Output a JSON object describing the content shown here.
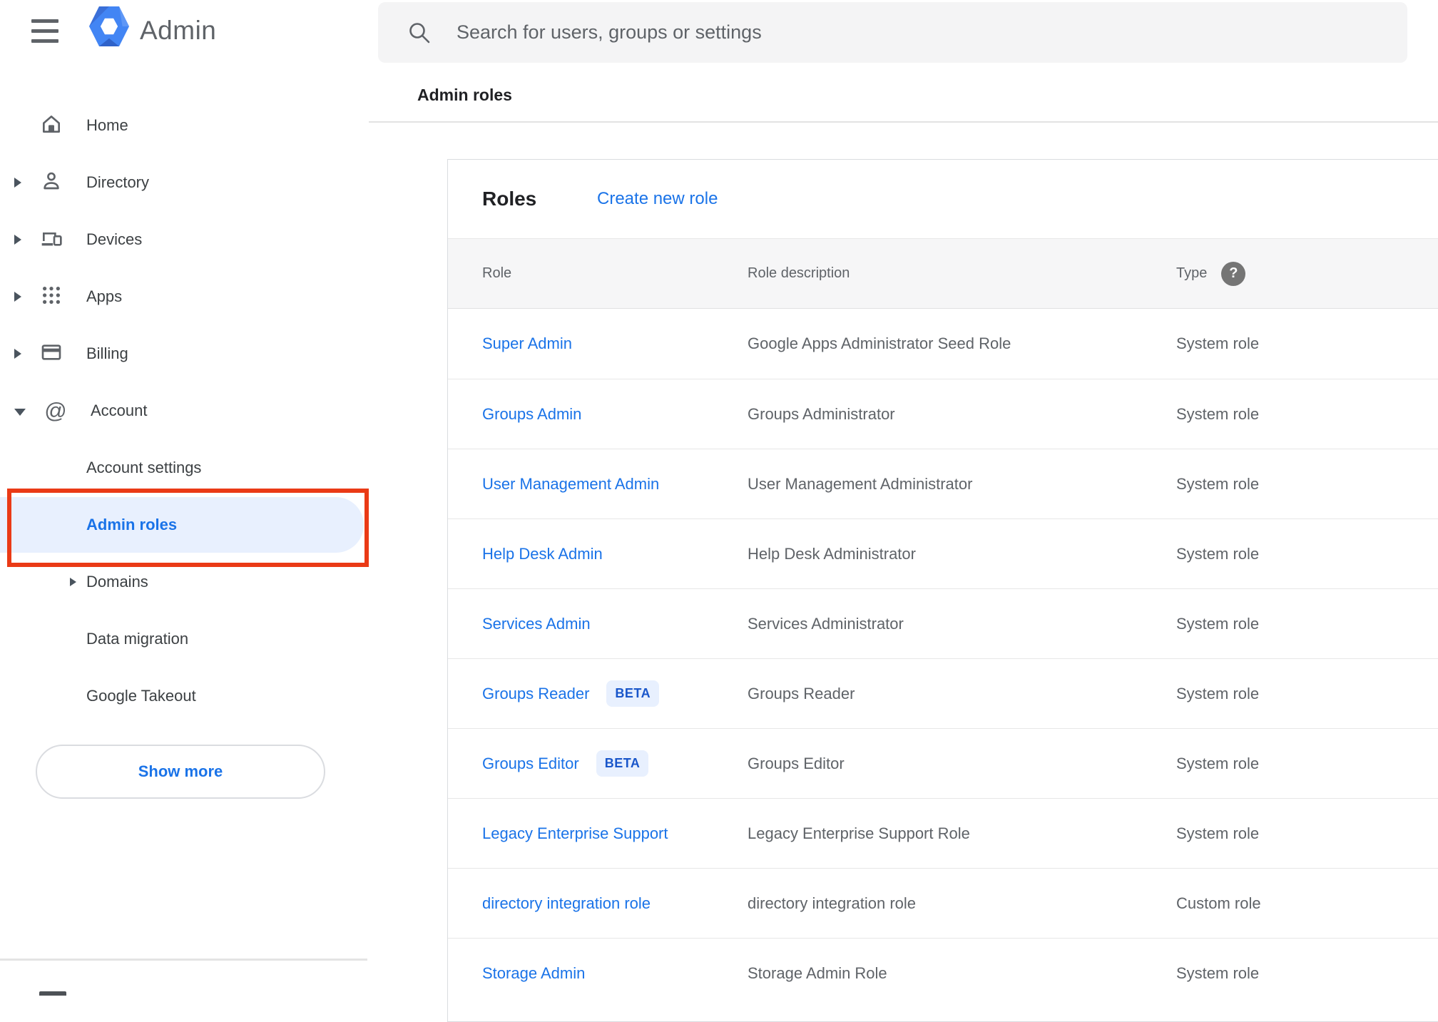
{
  "app": {
    "title": "Admin"
  },
  "search": {
    "placeholder": "Search for users, groups or settings"
  },
  "breadcrumb": "Admin roles",
  "sidebar": {
    "items": [
      {
        "label": "Home",
        "icon": "home",
        "expandable": false,
        "expanded": false
      },
      {
        "label": "Directory",
        "icon": "person",
        "expandable": true,
        "expanded": false
      },
      {
        "label": "Devices",
        "icon": "devices",
        "expandable": true,
        "expanded": false
      },
      {
        "label": "Apps",
        "icon": "apps",
        "expandable": true,
        "expanded": false
      },
      {
        "label": "Billing",
        "icon": "card",
        "expandable": true,
        "expanded": false
      },
      {
        "label": "Account",
        "icon": "at",
        "expandable": true,
        "expanded": true
      }
    ],
    "account_children": [
      {
        "label": "Account settings",
        "expandable": false,
        "selected": false
      },
      {
        "label": "Admin roles",
        "expandable": false,
        "selected": true
      },
      {
        "label": "Domains",
        "expandable": true,
        "selected": false
      },
      {
        "label": "Data migration",
        "expandable": false,
        "selected": false
      },
      {
        "label": "Google Takeout",
        "expandable": false,
        "selected": false
      }
    ],
    "show_more_label": "Show more"
  },
  "roles_card": {
    "title": "Roles",
    "create_link": "Create new role",
    "columns": [
      "Role",
      "Role description",
      "Type"
    ],
    "beta_label": "BETA",
    "rows": [
      {
        "role": "Super Admin",
        "beta": false,
        "description": "Google Apps Administrator Seed Role",
        "type": "System role"
      },
      {
        "role": "Groups Admin",
        "beta": false,
        "description": "Groups Administrator",
        "type": "System role"
      },
      {
        "role": "User Management Admin",
        "beta": false,
        "description": "User Management Administrator",
        "type": "System role"
      },
      {
        "role": "Help Desk Admin",
        "beta": false,
        "description": "Help Desk Administrator",
        "type": "System role"
      },
      {
        "role": "Services Admin",
        "beta": false,
        "description": "Services Administrator",
        "type": "System role"
      },
      {
        "role": "Groups Reader",
        "beta": true,
        "description": "Groups Reader",
        "type": "System role"
      },
      {
        "role": "Groups Editor",
        "beta": true,
        "description": "Groups Editor",
        "type": "System role"
      },
      {
        "role": "Legacy Enterprise Support",
        "beta": false,
        "description": "Legacy Enterprise Support Role",
        "type": "System role"
      },
      {
        "role": "directory integration role",
        "beta": false,
        "description": "directory integration role",
        "type": "Custom role"
      },
      {
        "role": "Storage Admin",
        "beta": false,
        "description": "Storage Admin Role",
        "type": "System role"
      }
    ]
  },
  "icons": {
    "at_glyph": "@",
    "help_glyph": "?"
  },
  "colors": {
    "link_blue": "#1a73e8",
    "annotation_red": "#ea3a16",
    "selected_bg": "#e8f0fe",
    "beta_bg": "#e8f0fe",
    "beta_text": "#1956ca",
    "gray_text": "#5f6368",
    "sidebar_text": "#3c4043",
    "header_bg": "#f6f6f7",
    "searchbar_bg": "#f4f4f5",
    "logo_blue": "#4285f4"
  }
}
